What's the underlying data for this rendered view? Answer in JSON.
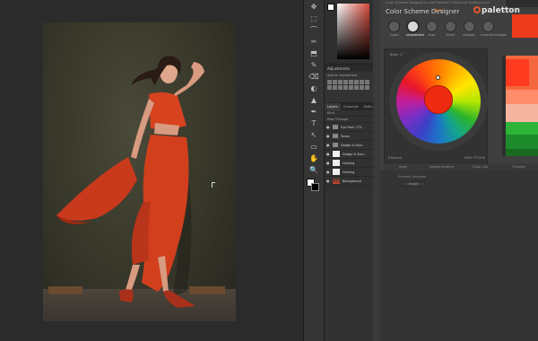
{
  "paletton": {
    "top_text": "Color Scheme Designer is now Paletton! Check out Paletton.com",
    "title": "Color Scheme Designer",
    "badge": "Beta",
    "logo": "paletton",
    "modes": [
      {
        "label": "mono",
        "active": false
      },
      {
        "label": "complement",
        "active": true
      },
      {
        "label": "triad",
        "active": false
      },
      {
        "label": "tetrad",
        "active": false
      },
      {
        "label": "analogic",
        "active": false
      },
      {
        "label": "accented analogic",
        "active": false
      }
    ],
    "base_label": "Base: 2°",
    "wheel_footer_left": "Distance",
    "wheel_footer_right": "RGB: FF3300",
    "bottom_tabs": [
      "Base",
      "Adjust Scheme",
      "Color List",
      "Preview"
    ],
    "below_text": "Scheme Designer",
    "below_button": "Export",
    "main_color": "#ee3c1c",
    "swatch_colors": [
      "#f5673e",
      "#ff8c6a",
      "#ff3a1e",
      "#f6b5a0",
      "#1d8a2b",
      "#1a6b22",
      "#2fb43a"
    ]
  },
  "photoshop": {
    "adjustments_title": "Adjustments",
    "adjustments_sub": "Add an adjustment",
    "tabs": [
      "Layers",
      "Channels",
      "Paths"
    ],
    "kind_label": "Kind",
    "blend_mode": "Pass Through",
    "layers": [
      {
        "name": "Eye Red / CTL",
        "type": "folder"
      },
      {
        "name": "Tones",
        "type": "folder"
      },
      {
        "name": "Dodge & Burn",
        "type": "folder"
      },
      {
        "name": "Dodge & Burn",
        "type": "white"
      },
      {
        "name": "Healing",
        "type": "white"
      },
      {
        "name": "Healing",
        "type": "white"
      },
      {
        "name": "Background",
        "type": "photo"
      }
    ],
    "tools": [
      "✥",
      "⬚",
      "⌒",
      "✂",
      "⬒",
      "✎",
      "⌫",
      "◐",
      "▲",
      "✒",
      "T",
      "↖",
      "▭",
      "✋",
      "🔍"
    ]
  }
}
